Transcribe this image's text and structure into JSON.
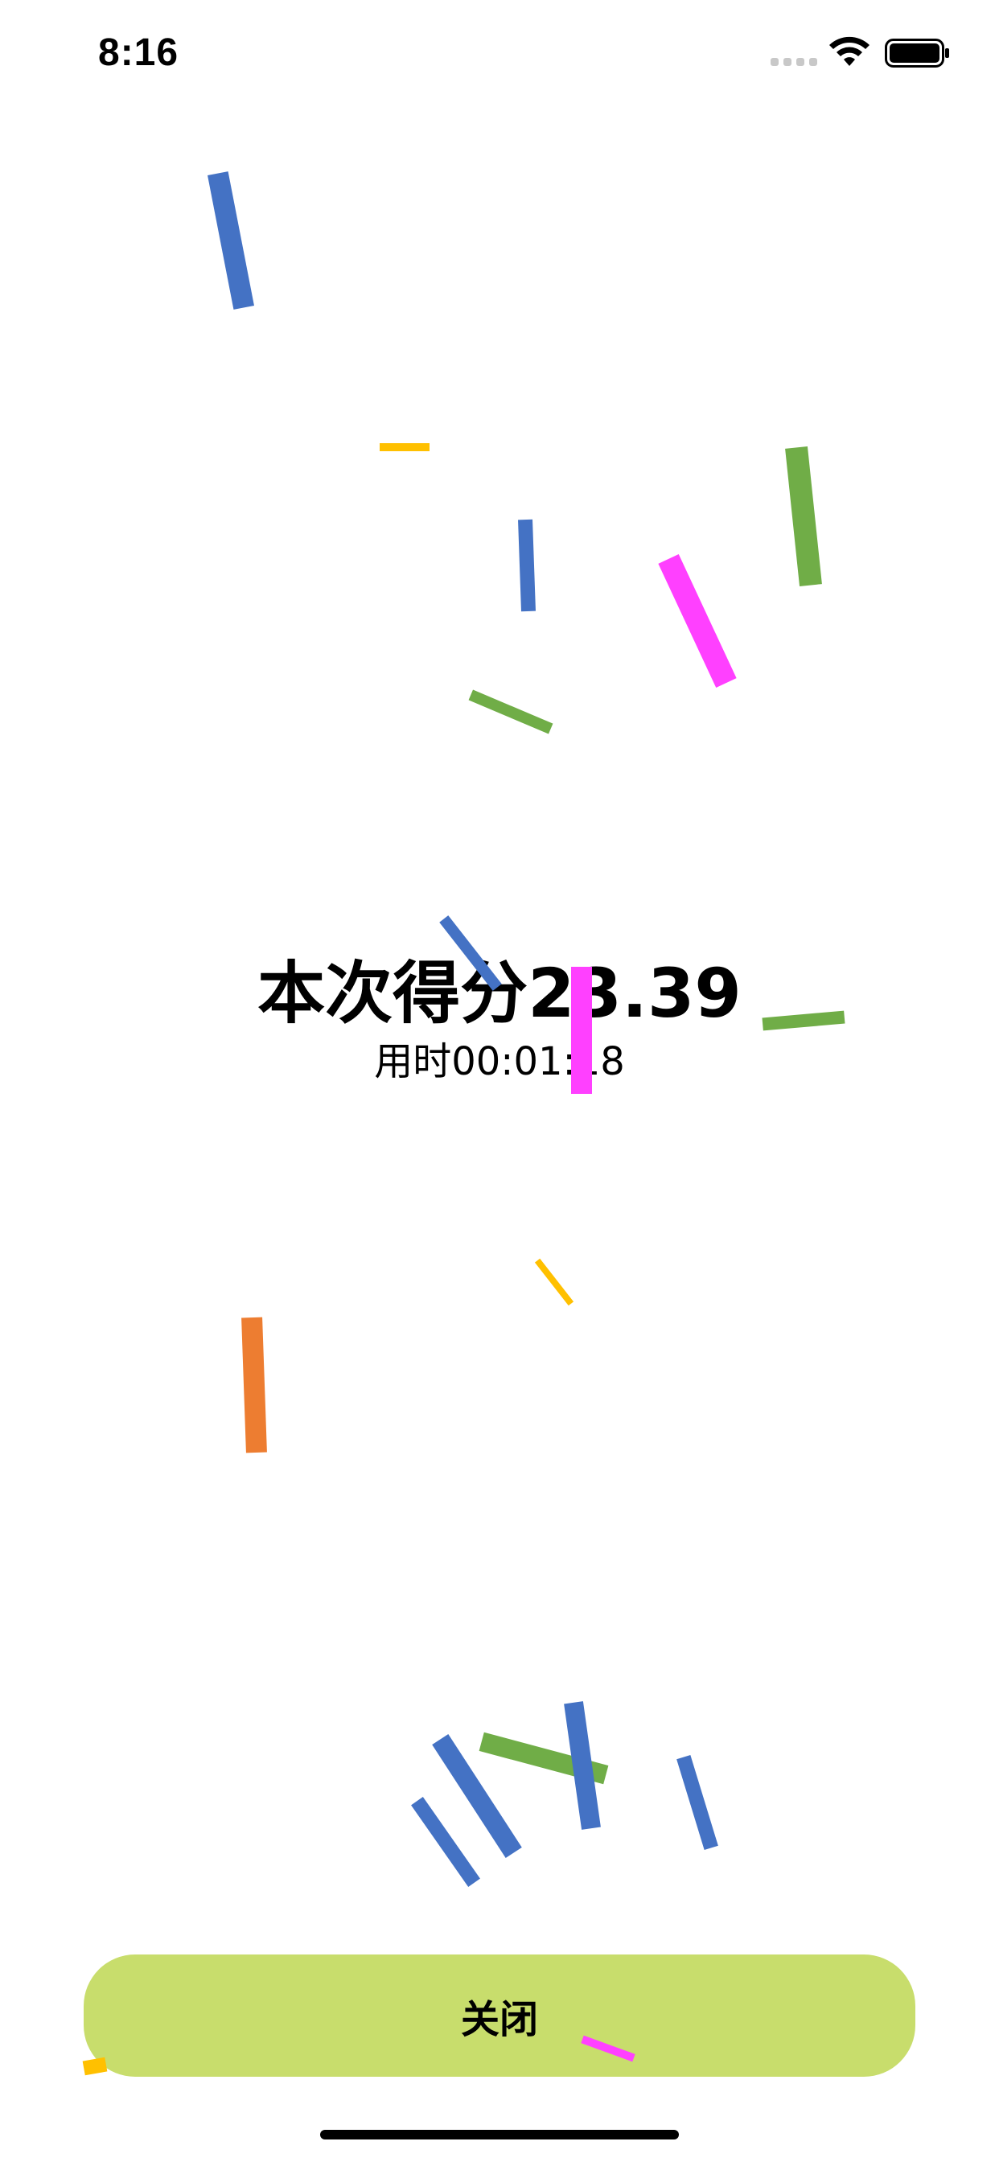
{
  "status_bar": {
    "time": "8:16"
  },
  "result": {
    "score_text": "本次得分23.39",
    "time_text": "用时00:01:18"
  },
  "close_button": {
    "label": "关闭"
  },
  "icons": {
    "wifi": "wifi-icon",
    "battery": "battery-icon",
    "signal": "signal-dots-icon"
  },
  "colors": {
    "background": "#ffffff",
    "button": "#c8dd6c",
    "confetti_blue": "#4472c4",
    "confetti_green": "#70ad47",
    "confetti_magenta": "#ff40ff",
    "confetti_yellow": "#ffc000",
    "confetti_orange": "#ed7d31"
  }
}
